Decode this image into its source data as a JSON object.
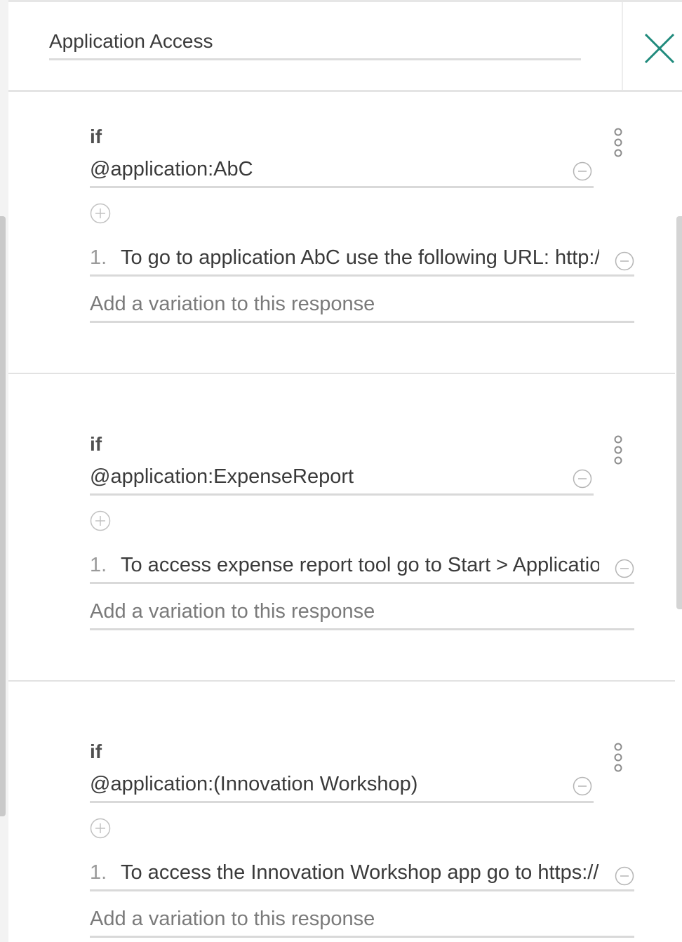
{
  "header": {
    "title": "Application Access"
  },
  "colors": {
    "close_icon": "#1f8a7c",
    "divider": "#e2e2e2",
    "icon_gray": "#8c8c8c"
  },
  "sections": [
    {
      "if_label": "if",
      "condition": "@application:AbC",
      "responses": [
        {
          "number": "1.",
          "text": "To go to application AbC use the following URL: http://www.abc.com"
        }
      ],
      "add_variation_placeholder": "Add a variation to this response"
    },
    {
      "if_label": "if",
      "condition": "@application:ExpenseReport",
      "responses": [
        {
          "number": "1.",
          "text": "To access expense report tool go to Start > Applications"
        }
      ],
      "add_variation_placeholder": "Add a variation to this response"
    },
    {
      "if_label": "if",
      "condition": "@application:(Innovation Workshop)",
      "responses": [
        {
          "number": "1.",
          "text": "To access the Innovation Workshop app go to https://iw"
        }
      ],
      "add_variation_placeholder": "Add a variation to this response"
    }
  ]
}
